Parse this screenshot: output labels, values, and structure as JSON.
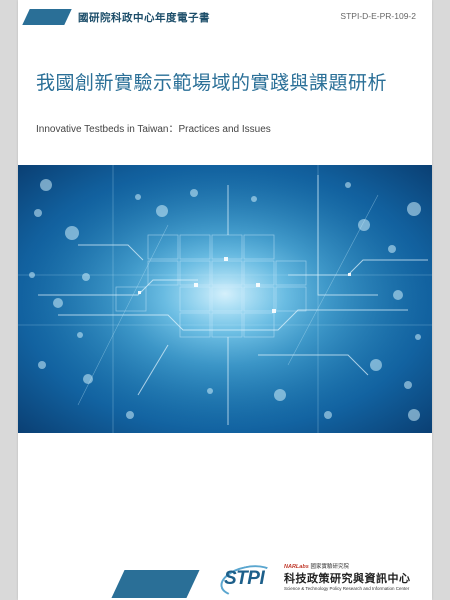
{
  "header": {
    "series_label": "國研院科政中心年度電子書",
    "doc_id": "STPI-D-E-PR-109-2"
  },
  "cover": {
    "title_zh": "我國創新實驗示範場域的實踐與課題研析",
    "title_en": "Innovative Testbeds in Taiwan：Practices and Issues"
  },
  "footer": {
    "logo_text": "STPI",
    "narlabs_prefix": "NARLabs",
    "narlabs_text": "國家實驗研究院",
    "org_name_zh": "科技政策研究與資訊中心",
    "org_name_en": "Science & Technology Policy Research and Information Center"
  },
  "colors": {
    "brand": "#2a6f97",
    "hero_light": "#6fc6ea",
    "hero_dark": "#0a3f73"
  }
}
